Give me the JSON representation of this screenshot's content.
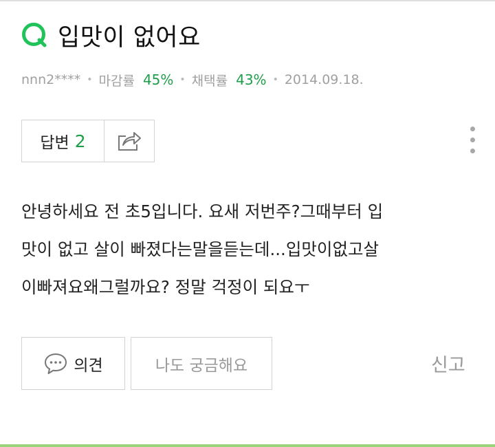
{
  "question": {
    "title": "입맛이 없어요",
    "author": "nnn2****",
    "deadline_label": "마감률",
    "deadline_rate": "45%",
    "adoption_label": "채택률",
    "adoption_rate": "43%",
    "date": "2014.09.18.",
    "body_lines": [
      "안녕하세요 전 초5입니다. 요새 저번주?그때부터 입",
      "맛이 없고 살이 빠졌다는말을듣는데...입맛이없고살",
      "이빠져요왜그럴까요? 정말 걱정이 되요ㅜ"
    ]
  },
  "actions": {
    "answer_label": "답변",
    "answer_count": "2",
    "opinion_label": "의견",
    "curious_label": "나도 궁금해요",
    "report_label": "신고"
  },
  "icons": {
    "q": "q-icon",
    "share": "share-icon",
    "more": "more-vertical-icon",
    "comment": "comment-icon"
  },
  "colors": {
    "accent": "#1f9e4a",
    "meta_text": "#a0a0a0",
    "border": "#d3d3d3"
  }
}
